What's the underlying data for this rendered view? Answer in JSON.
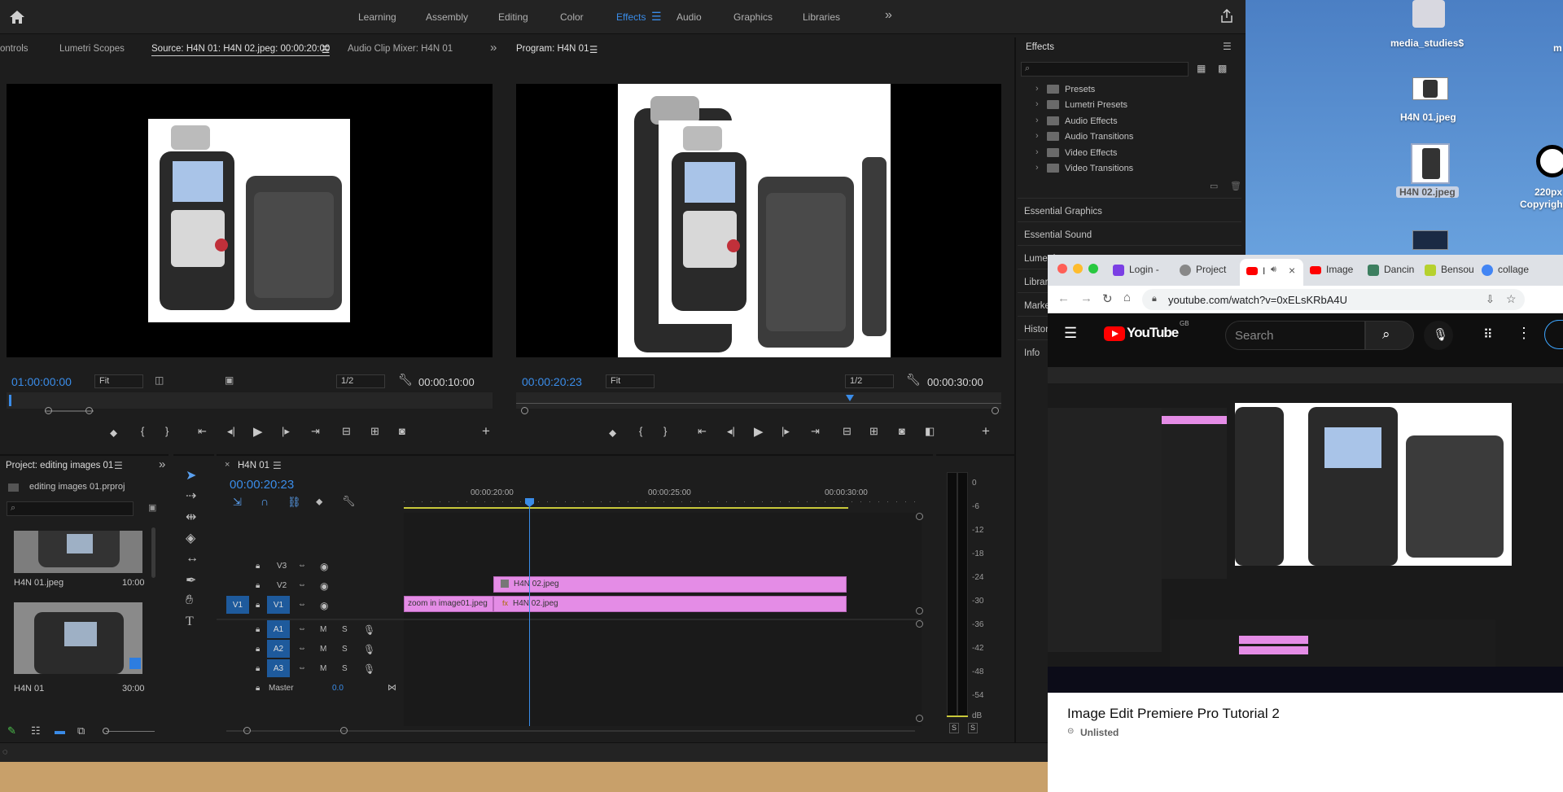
{
  "workspaces": [
    "Learning",
    "Assembly",
    "Editing",
    "Color",
    "Effects",
    "Audio",
    "Graphics",
    "Libraries"
  ],
  "active_workspace": "Effects",
  "source_panel": {
    "tabs": [
      "ontrols",
      "Lumetri Scopes",
      "Source: H4N 01: H4N 02.jpeg: 00:00:20:00",
      "Audio Clip Mixer: H4N 01"
    ],
    "timecode": "01:00:00:00",
    "fit": "Fit",
    "resolution": "1/2",
    "duration": "00:00:10:00"
  },
  "program_panel": {
    "title": "Program: H4N 01",
    "timecode": "00:00:20:23",
    "fit": "Fit",
    "resolution": "1/2",
    "duration": "00:00:30:00"
  },
  "effects_panel": {
    "title": "Effects",
    "items": [
      "Presets",
      "Lumetri Presets",
      "Audio Effects",
      "Audio Transitions",
      "Video Effects",
      "Video Transitions"
    ],
    "sections": [
      "Essential Graphics",
      "Essential Sound",
      "Lumetri",
      "Libraries",
      "Markers",
      "History",
      "Info"
    ]
  },
  "project_panel": {
    "title": "Project: editing images 01",
    "filename": "editing images 01.prproj",
    "items": [
      {
        "name": "H4N 01.jpeg",
        "duration": "10:00"
      },
      {
        "name": "H4N 01",
        "duration": "30:00"
      }
    ]
  },
  "timeline": {
    "title": "H4N 01",
    "timecode": "00:00:20:23",
    "ruler": [
      "00:00:20:00",
      "00:00:25:00",
      "00:00:30:00"
    ],
    "video_tracks": [
      "V3",
      "V2",
      "V1"
    ],
    "audio_tracks": [
      "A1",
      "A2",
      "A3"
    ],
    "source_patch": "V1",
    "master_label": "Master",
    "master_value": "0.0",
    "clips": [
      {
        "track": "V2",
        "label": "H4N 02.jpeg"
      },
      {
        "track": "V1",
        "label": "zoom in image01.jpeg"
      },
      {
        "track": "V1",
        "label": "H4N 02.jpeg"
      }
    ]
  },
  "meter": {
    "scale": [
      "0",
      "-6",
      "-12",
      "-18",
      "-24",
      "-30",
      "-36",
      "-42",
      "-48",
      "-54",
      "dB"
    ],
    "solo": [
      "S",
      "S"
    ]
  },
  "desktop_icons": [
    "media_studies$",
    "H4N 01.jpeg",
    "H4N 02.jpeg",
    "220px",
    "Copyright.s",
    "m"
  ],
  "browser": {
    "tabs": [
      "Login -",
      "Project",
      "I",
      "Image",
      "Dancin",
      "Bensou",
      "collage"
    ],
    "url": "youtube.com/watch?v=0xELsKRbA4U",
    "search_placeholder": "Search",
    "gb_badge": "GB",
    "youtube_logo": "YouTube",
    "video_title": "Image Edit Premiere Pro Tutorial 2",
    "visibility": "Unlisted"
  },
  "colors": {
    "accent": "#3a8ce8",
    "clip_pink": "#e48ce6",
    "youtube_red": "#ff0000"
  }
}
